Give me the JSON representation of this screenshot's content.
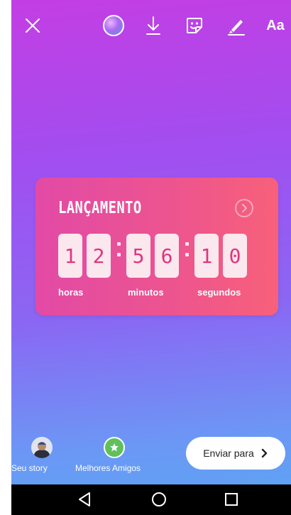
{
  "top_toolbar": {
    "close_icon": "close-icon",
    "color_icon": "color-circle-icon",
    "download_icon": "download-icon",
    "sticker_icon": "sticker-icon",
    "draw_icon": "pen-icon",
    "text_label": "Aa"
  },
  "countdown": {
    "title": "LANÇAMENTO",
    "digits": [
      "1",
      "2",
      "5",
      "6",
      "1",
      "0"
    ],
    "units": {
      "hours": "horas",
      "minutes": "minutos",
      "seconds": "segundos"
    },
    "colors": {
      "gradient_start": "#e24aa6",
      "gradient_end": "#f8607a",
      "digit_bg": "#fbe7ee",
      "digit_text": "#e0357d"
    }
  },
  "bottom_bar": {
    "your_story_label": "Seu story",
    "close_friends_label": "Melhores Amigos",
    "send_label": "Enviar para"
  },
  "system_nav": {
    "back_icon": "back-triangle-icon",
    "home_icon": "home-circle-icon",
    "recents_icon": "recents-square-icon"
  }
}
